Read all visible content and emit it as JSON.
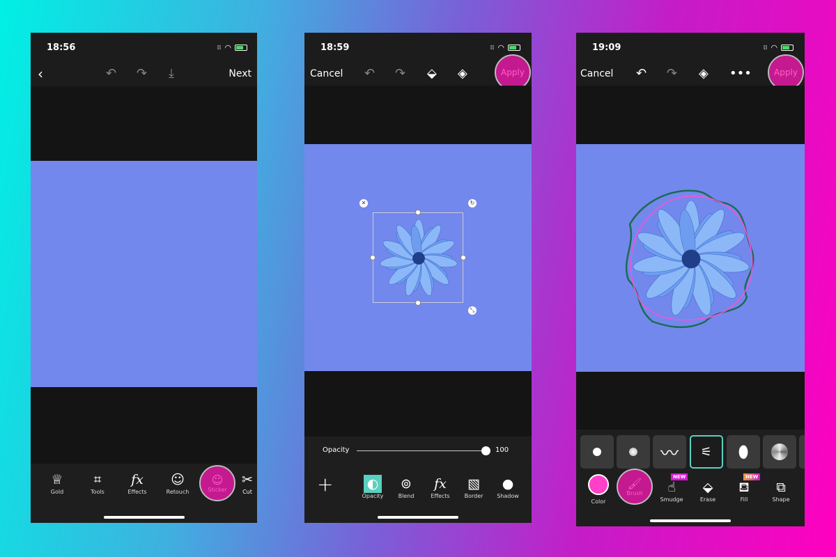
{
  "colors": {
    "accent": "#c4198f",
    "canvas": "#7388ec",
    "selected": "#5ad0c0"
  },
  "screen1": {
    "time": "18:56",
    "next": "Next",
    "tools": [
      {
        "label": "Gold",
        "icon": "crown-icon"
      },
      {
        "label": "Tools",
        "icon": "crop-icon"
      },
      {
        "label": "Effects",
        "icon": "fx-icon"
      },
      {
        "label": "Retouch",
        "icon": "retouch-icon"
      },
      {
        "label": "Sticker",
        "icon": "sticker-icon"
      },
      {
        "label": "Cut",
        "icon": "scissors-icon"
      }
    ]
  },
  "screen2": {
    "time": "18:59",
    "cancel": "Cancel",
    "apply": "Apply",
    "opacity_label": "Opacity",
    "opacity_value": "100",
    "opacity_level": 100,
    "tools": [
      {
        "label": "Opacity"
      },
      {
        "label": "Blend"
      },
      {
        "label": "Effects"
      },
      {
        "label": "Border"
      },
      {
        "label": "Shadow"
      }
    ]
  },
  "screen3": {
    "time": "19:09",
    "cancel": "Cancel",
    "apply": "Apply",
    "new_badge": "NEW",
    "tools": [
      {
        "label": "Color"
      },
      {
        "label": "Brush"
      },
      {
        "label": "Smudge"
      },
      {
        "label": "Erase"
      },
      {
        "label": "Fill"
      },
      {
        "label": "Shape"
      }
    ]
  }
}
